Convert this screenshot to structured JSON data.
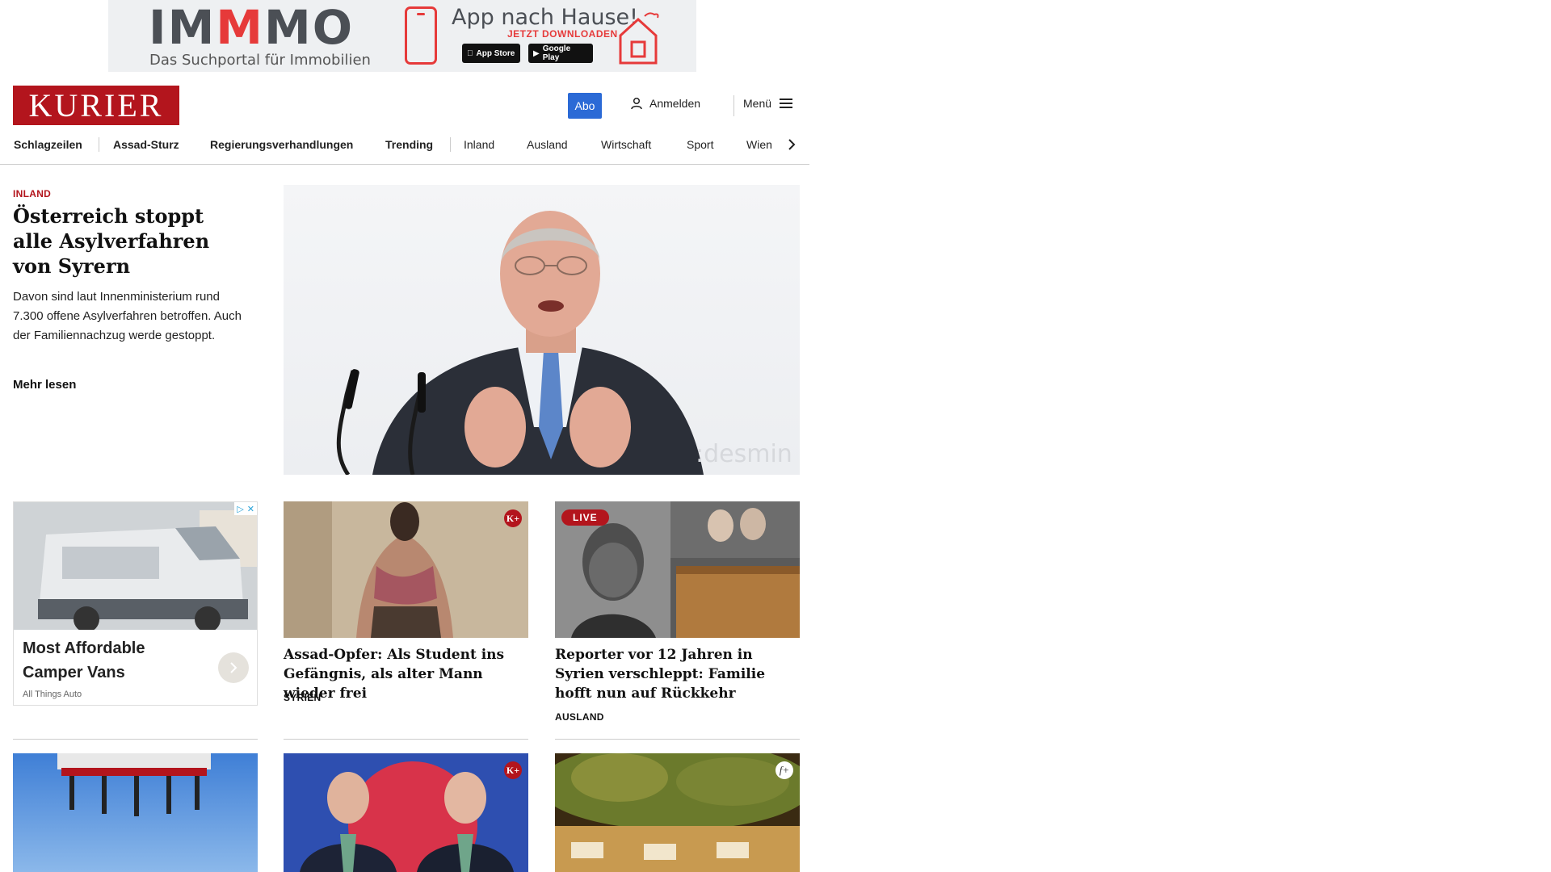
{
  "ad_banner": {
    "brand_start": "IM",
    "brand_m": "M",
    "brand_end": "MO",
    "subtitle": "Das Suchportal für Immobilien",
    "headline": "App nach Hause!",
    "cta": "JETZT DOWNLOADEN",
    "store_apple": "App Store",
    "store_google": "Google Play"
  },
  "header": {
    "logo": "KURIER",
    "abo_label": "Abo",
    "login_label": "Anmelden",
    "menu_label": "Menü"
  },
  "nav": {
    "items": [
      "Schlagzeilen",
      "Assad-Sturz",
      "Regierungsverhandlungen",
      "Trending",
      "Inland",
      "Ausland",
      "Wirtschaft",
      "Sport",
      "Wien"
    ]
  },
  "lead": {
    "kicker": "INLAND",
    "title": "Österreich stoppt alle Asylverfahren von Syrern",
    "teaser": "Davon sind laut Innenministerium rund 7.300 offene Asylverfahren betroffen. Auch der Familiennachzug werde gestoppt.",
    "more": "Mehr lesen",
    "watermark": ":desmin"
  },
  "sponsored": {
    "title": "Most Affordable Camper Vans",
    "source": "All Things Auto"
  },
  "cards": [
    {
      "title": "Assad-Opfer: Als Student ins Ge­fängnis, als alter Mann wieder frei",
      "kicker": "SYRIEN",
      "badge": "K+"
    },
    {
      "title": "Reporter vor 12 Jahren in Syrien verschleppt: Familie hofft nun auf Rückkehr",
      "kicker": "AUSLAND",
      "badge": "LIVE"
    }
  ],
  "row2": {
    "badge_middle": "K+",
    "badge_right": "f+"
  },
  "colors": {
    "brand_red": "#b3151d",
    "abo_blue": "#2b6ad6"
  }
}
